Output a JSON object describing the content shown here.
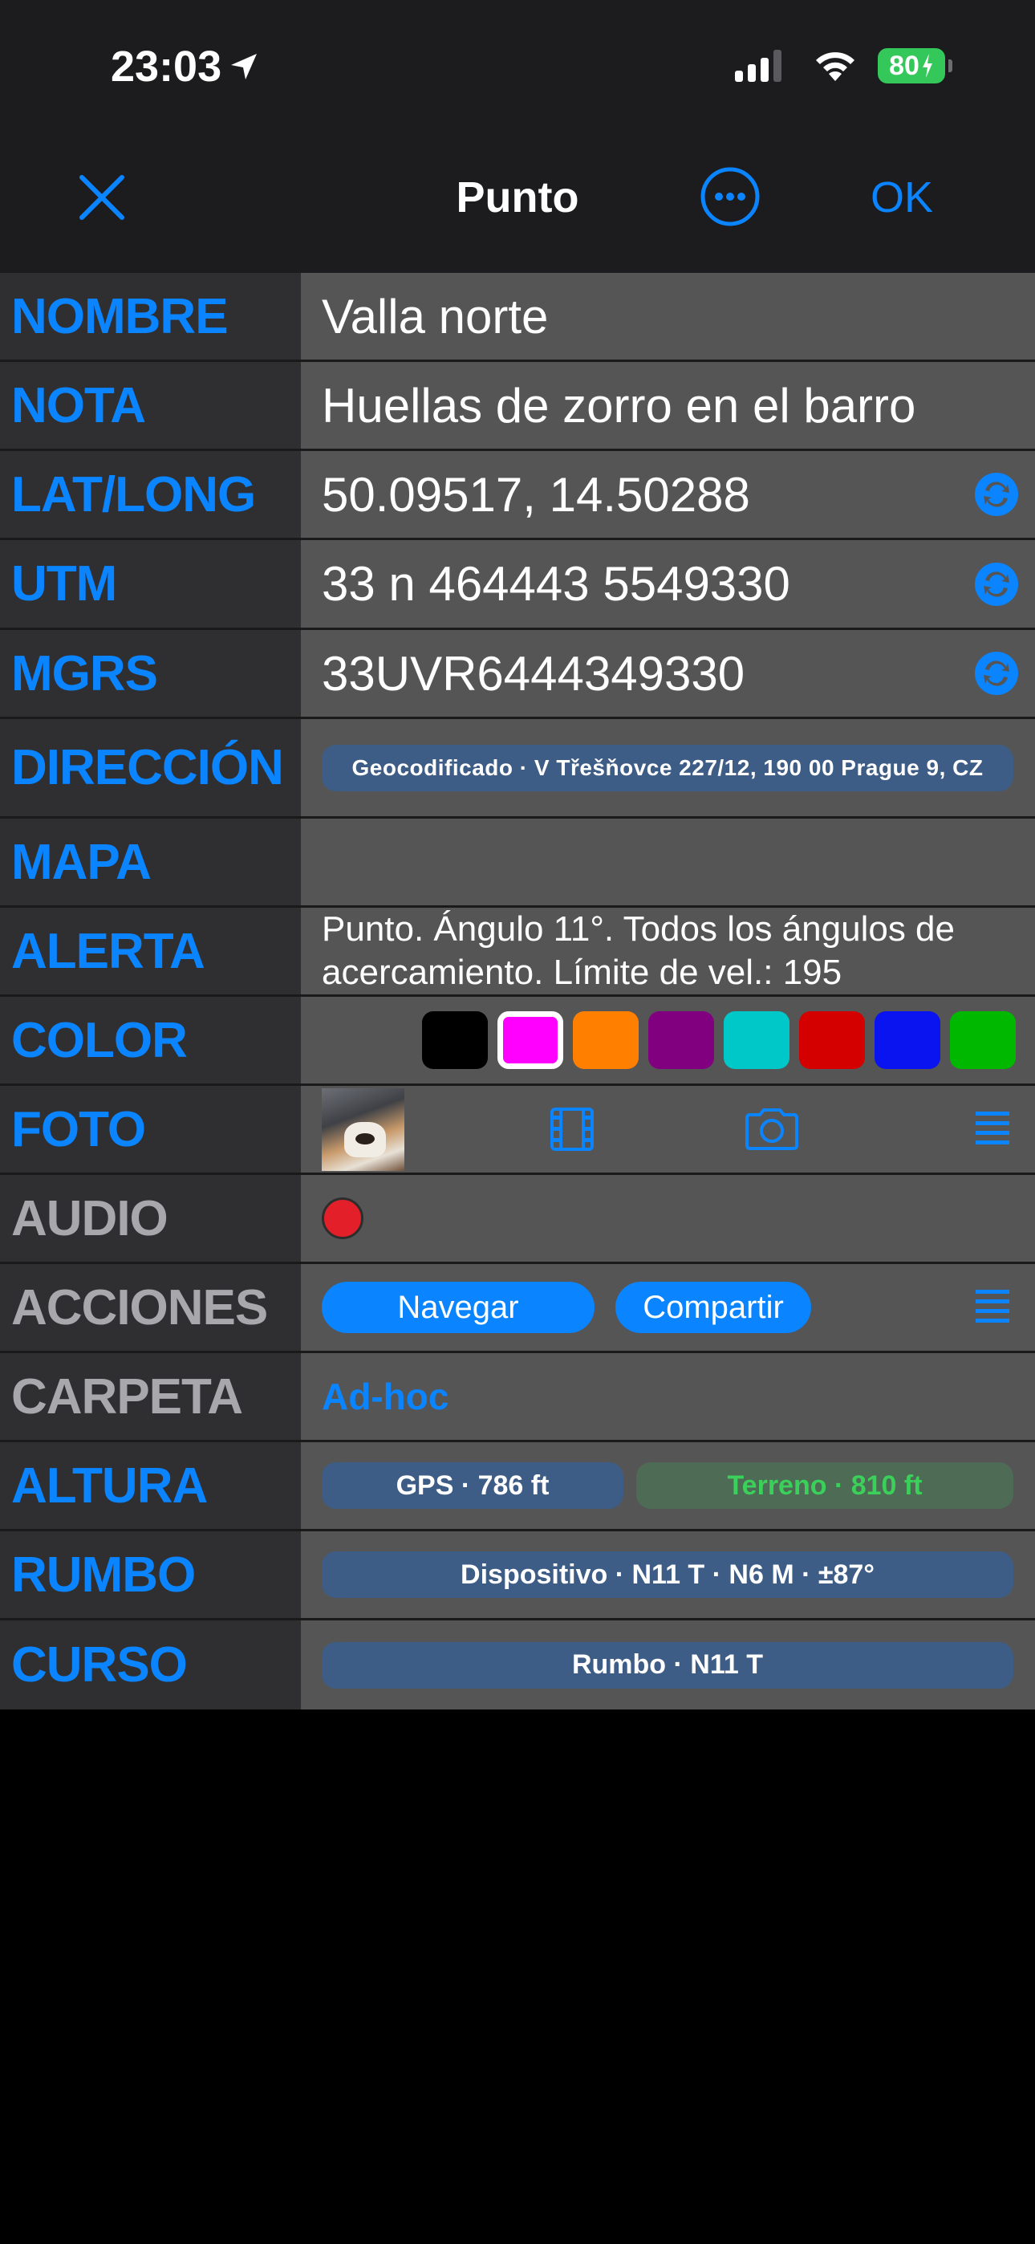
{
  "status_bar": {
    "time": "23:03",
    "battery": "80",
    "icons": [
      "location-arrow-icon",
      "cellular-signal-icon",
      "wifi-icon",
      "battery-charging-icon"
    ]
  },
  "navbar": {
    "title": "Punto",
    "ok_label": "OK",
    "close_icon": "close-icon",
    "more_icon": "more-options-icon"
  },
  "fields": {
    "nombre": {
      "label": "NOMBRE",
      "value": "Valla norte"
    },
    "nota": {
      "label": "NOTA",
      "value": "Huellas de zorro en el barro"
    },
    "latlong": {
      "label": "LAT/LONG",
      "value": "50.09517, 14.50288"
    },
    "utm": {
      "label": "UTM",
      "value": "33 n 464443 5549330"
    },
    "mgrs": {
      "label": "MGRS",
      "value": "33UVR6444349330"
    },
    "direccion": {
      "label": "DIRECCIÓN",
      "value": "Geocodificado · V Třešňovce 227/12, 190 00 Prague 9, CZ"
    },
    "mapa": {
      "label": "MAPA",
      "value": ""
    },
    "alerta": {
      "label": "ALERTA",
      "value": "Punto. Ángulo 11°.  Todos los ángulos de acercamiento. Límite de vel.: 195"
    },
    "color": {
      "label": "COLOR",
      "swatches": [
        "#000000",
        "#ff00ff",
        "#ff8000",
        "#800080",
        "#00c8c8",
        "#d40000",
        "#0a14f0",
        "#00b800"
      ],
      "selected": "#ff00ff"
    },
    "foto": {
      "label": "FOTO",
      "icons": [
        "photo-thumbnail",
        "film-strip-icon",
        "camera-icon",
        "list-icon"
      ]
    },
    "audio": {
      "label": "AUDIO",
      "icon": "record-icon"
    },
    "acciones": {
      "label": "ACCIONES",
      "navegar": "Navegar",
      "compartir": "Compartir"
    },
    "carpeta": {
      "label": "CARPETA",
      "value": "Ad-hoc"
    },
    "altura": {
      "label": "ALTURA",
      "gps": "GPS · 786 ft",
      "terreno": "Terreno · 810 ft"
    },
    "rumbo": {
      "label": "RUMBO",
      "value": "Dispositivo · N11 T · N6 M · ±87°"
    },
    "curso": {
      "label": "CURSO",
      "value": "Rumbo · N11 T"
    }
  },
  "colors": {
    "accent": "#0a84ff",
    "label_bg": "#2f2f31",
    "value_bg": "#555556",
    "pill_blue": "#3e5d86",
    "pill_green_bg": "#4d6b55",
    "pill_green_text": "#3bd05a"
  }
}
